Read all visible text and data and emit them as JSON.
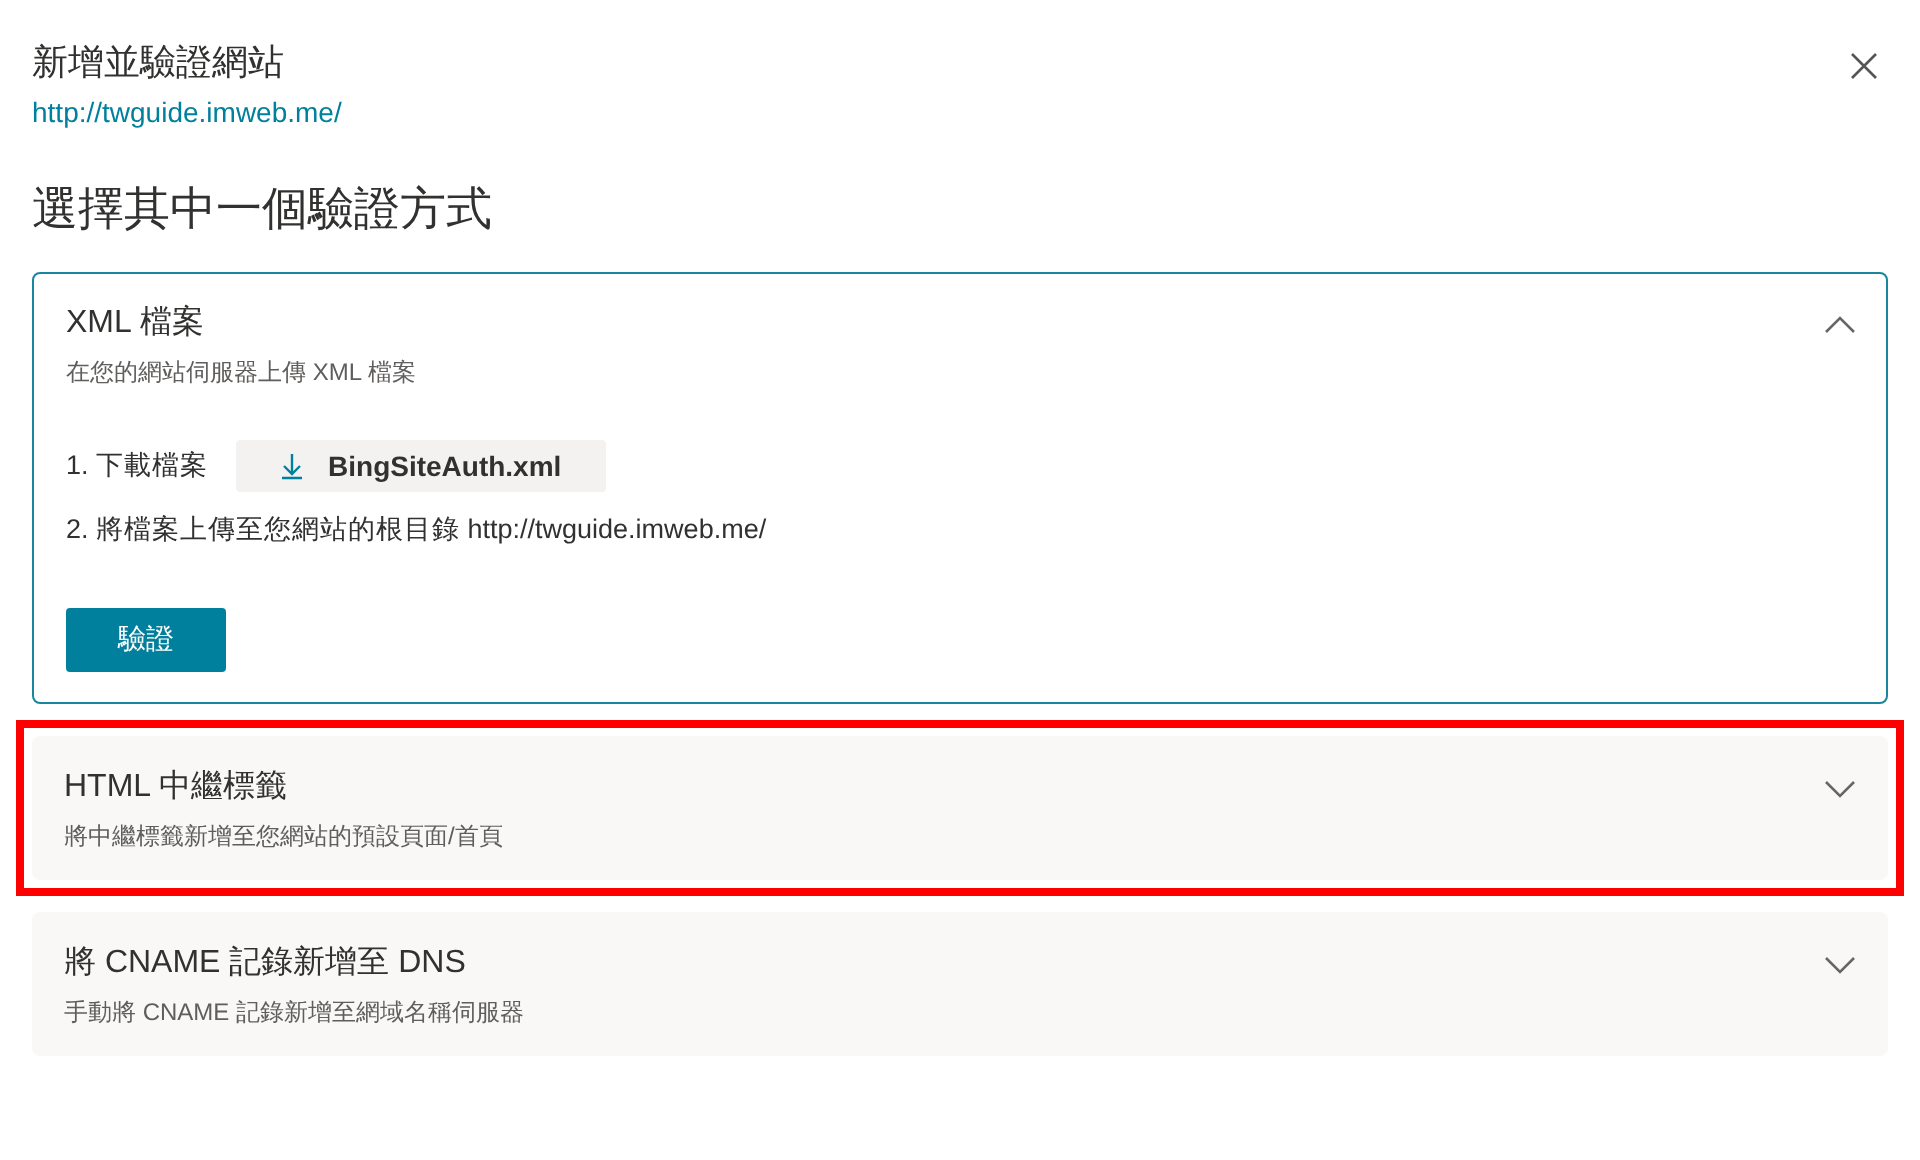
{
  "dialog": {
    "title": "新增並驗證網站",
    "url": "http://twguide.imweb.me/",
    "heading": "選擇其中一個驗證方式"
  },
  "options": [
    {
      "title": "XML 檔案",
      "description": "在您的網站伺服器上傳 XML 檔案",
      "expanded": true,
      "highlighted": false,
      "steps": [
        {
          "kind": "download",
          "text": "1. 下載檔案",
          "file": "BingSiteAuth.xml"
        },
        {
          "kind": "text",
          "text": "2. 將檔案上傳至您網站的根目錄 http://twguide.imweb.me/"
        }
      ],
      "verify_button": "驗證"
    },
    {
      "title": "HTML 中繼標籤",
      "description": "將中繼標籤新增至您網站的預設頁面/首頁",
      "expanded": false,
      "highlighted": true
    },
    {
      "title": "將 CNAME 記錄新增至 DNS",
      "description": "手動將 CNAME 記錄新增至網域名稱伺服器",
      "expanded": false,
      "highlighted": false
    }
  ]
}
